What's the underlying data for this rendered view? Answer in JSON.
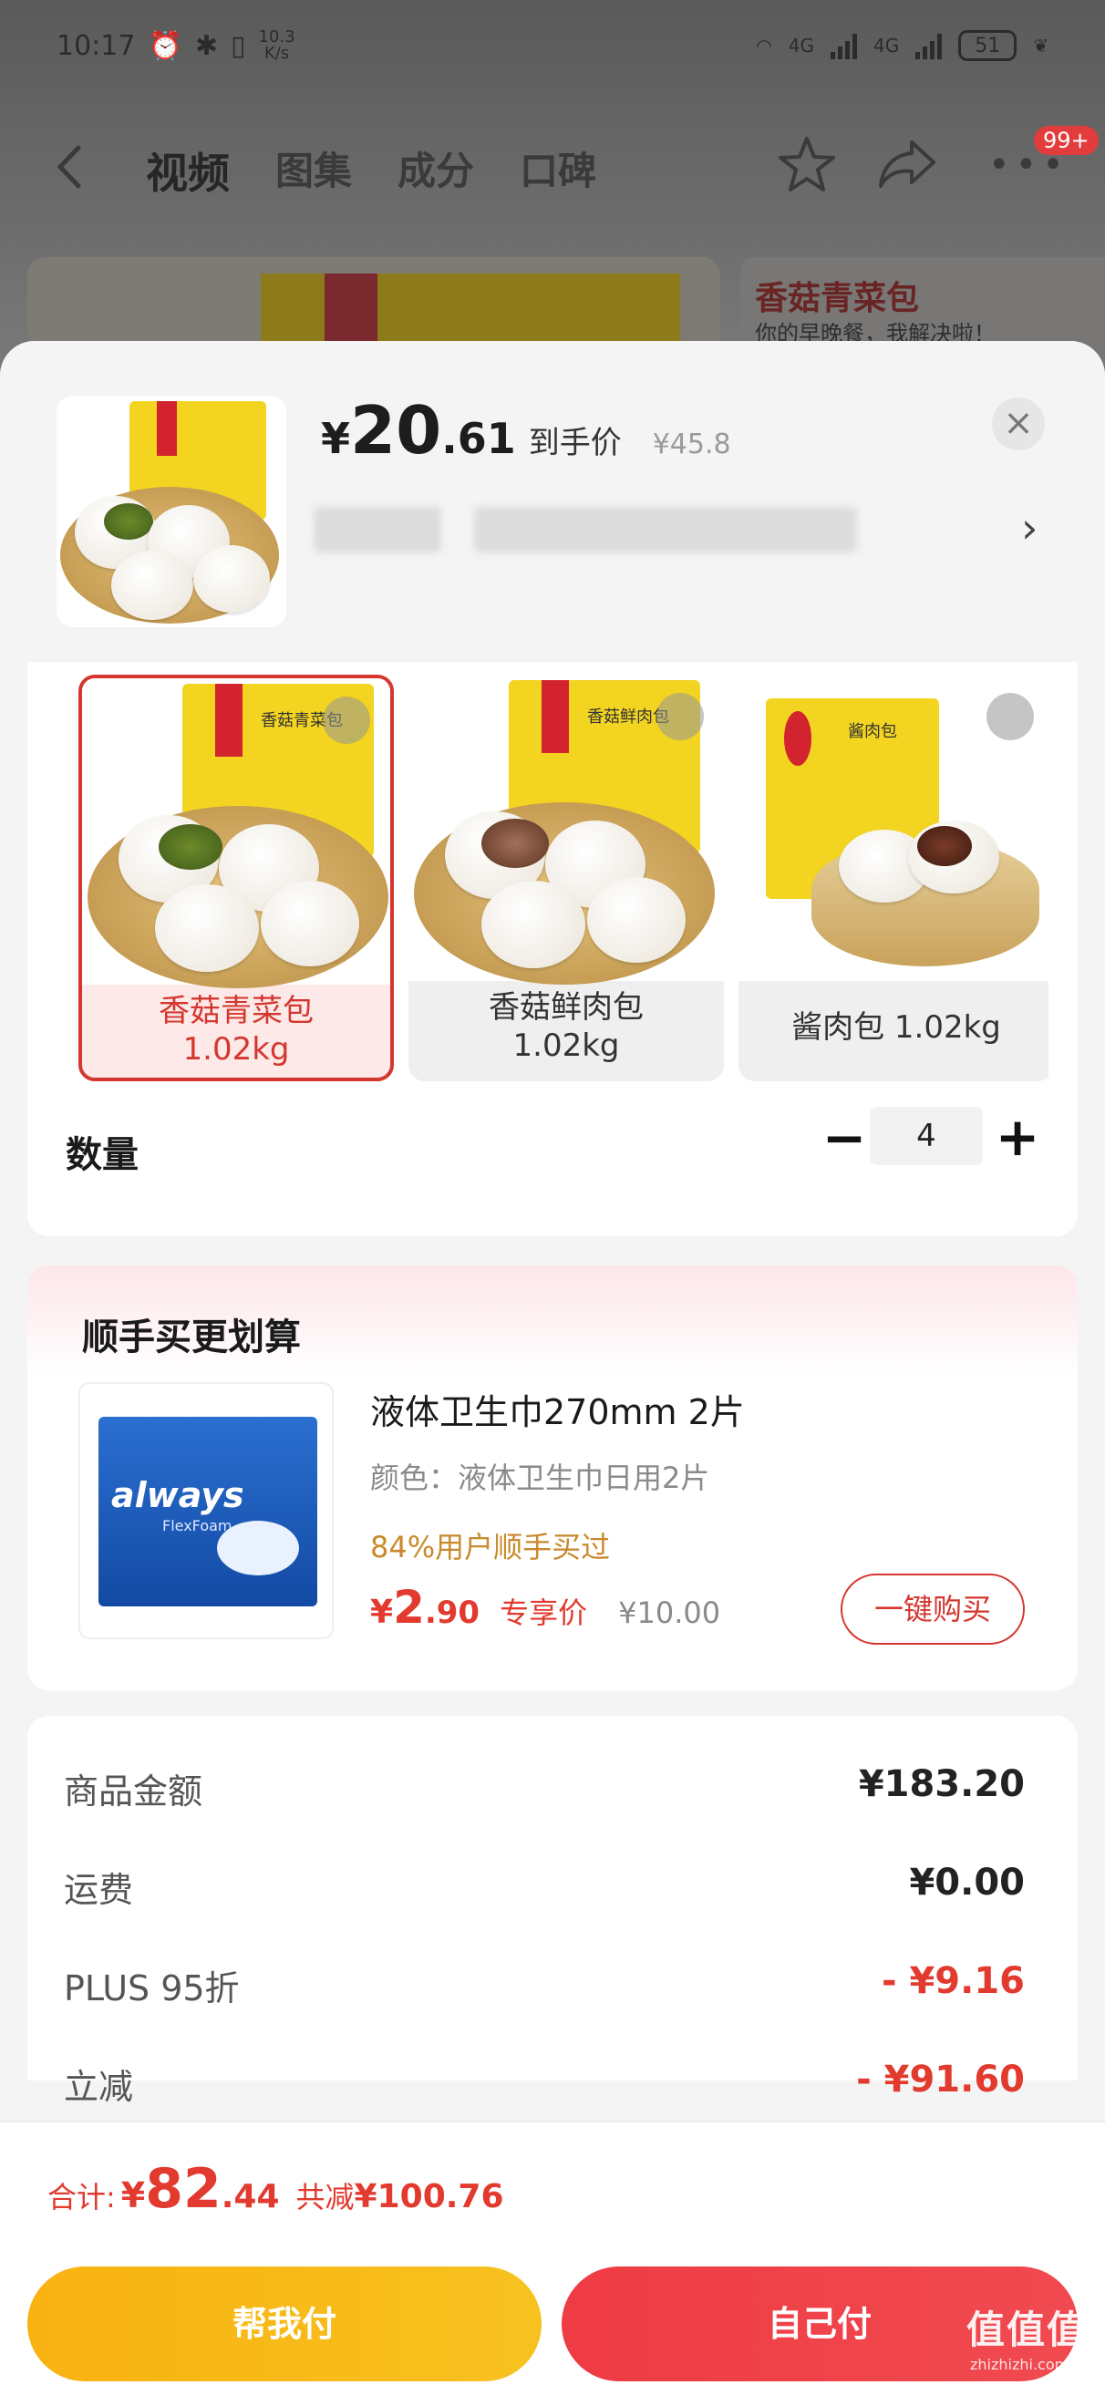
{
  "status_bar": {
    "time": "10:17",
    "speed_value": "10.3",
    "speed_unit": "K/s",
    "network_1": "4G",
    "network_2": "4G",
    "battery": "51"
  },
  "top_nav": {
    "tabs": [
      {
        "label": "视频",
        "active": true
      },
      {
        "label": "图集",
        "active": false
      },
      {
        "label": "成分",
        "active": false
      },
      {
        "label": "口碑",
        "active": false
      }
    ],
    "badge": "99+"
  },
  "background_banner": {
    "title": "香菇青菜包",
    "subtitle": "你的早晚餐，我解决啦！"
  },
  "product": {
    "price_symbol": "¥",
    "price_int": "20",
    "price_dec": ".61",
    "price_label": "到手价",
    "original_price": "¥45.8"
  },
  "specs": [
    {
      "name": "香菇青菜包",
      "weight": "1.02kg",
      "selected": true,
      "pack_label": "香菇青菜包"
    },
    {
      "name": "香菇鲜肉包",
      "weight": "1.02kg",
      "selected": false,
      "pack_label": "香菇鲜肉包"
    },
    {
      "name": "酱肉包 1.02kg",
      "weight": "",
      "selected": false,
      "pack_label": "酱肉包"
    }
  ],
  "quantity": {
    "label": "数量",
    "minus": "−",
    "value": "4",
    "plus": "+"
  },
  "addon": {
    "title": "顺手买更划算",
    "name": "液体卫生巾270mm 2片",
    "variant": "颜色：液体卫生巾日用2片",
    "social": "84%用户顺手买过",
    "price_symbol": "¥",
    "price_int": "2",
    "price_dec": ".90",
    "price_label": "专享价",
    "original_price": "¥10.00",
    "buy_label": "一键购买",
    "brand": "always",
    "brand_sub": "FlexFoam"
  },
  "summary": [
    {
      "label": "商品金额",
      "value": "¥183.20",
      "red": false
    },
    {
      "label": "运费",
      "value": "¥0.00",
      "red": false
    },
    {
      "label": "PLUS 95折",
      "value": "- ¥9.16",
      "red": true
    },
    {
      "label": "立减",
      "value": "- ¥91.60",
      "red": true
    }
  ],
  "total": {
    "label": "合计:",
    "symbol": "¥",
    "int": "82",
    "dec": ".44",
    "saved_label": "共减",
    "saved_amount": "¥100.76"
  },
  "actions": {
    "help_pay": "帮我付",
    "self_pay": "自己付"
  },
  "watermark": {
    "main": "值值值",
    "sub": "zhizhizhi.com"
  },
  "colors": {
    "accent_red": "#e23a2e",
    "button_yellow": "#f9b211",
    "button_red": "#ef3b43",
    "selected_border": "#d4372f"
  }
}
